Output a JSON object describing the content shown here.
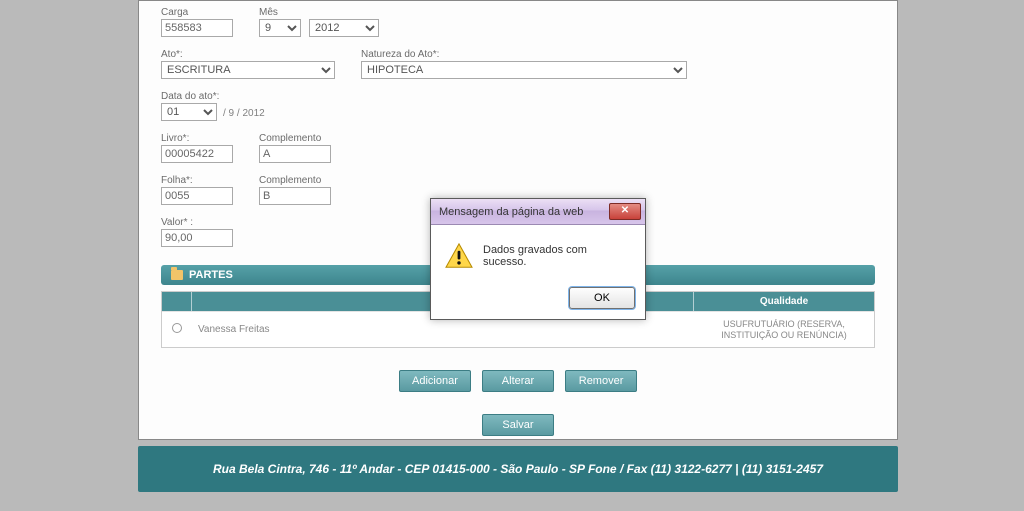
{
  "form": {
    "labels": {
      "carga": "Carga",
      "mes": "Mês",
      "ato": "Ato*:",
      "natureza": "Natureza do Ato*:",
      "dataAto": "Data do ato*:",
      "livro": "Livro*:",
      "complemento1": "Complemento",
      "folha": "Folha*:",
      "complemento2": "Complemento",
      "valor": "Valor* :"
    },
    "values": {
      "carga": "558583",
      "mes": "9",
      "ano": "2012",
      "ato": "ESCRITURA",
      "natureza": "HIPOTECA",
      "dia": "01",
      "dateTrail": "/ 9 / 2012",
      "livro": "00005422",
      "compLivro": "A",
      "folha": "0055",
      "compFolha": "B",
      "valor": "90,00"
    }
  },
  "partes": {
    "title": "PARTES",
    "headers": {
      "qualidade": "Qualidade"
    },
    "row": {
      "nome": "Vanessa Freitas",
      "qualidade": "USUFRUTUÁRIO (RESERVA, INSTITUIÇÃO OU RENÚNCIA)"
    }
  },
  "buttons": {
    "adicionar": "Adicionar",
    "alterar": "Alterar",
    "remover": "Remover",
    "salvar": "Salvar"
  },
  "footer": "Rua Bela Cintra, 746 - 11º Andar - CEP 01415-000 - São Paulo - SP Fone / Fax (11) 3122-6277 | (11) 3151-2457",
  "modal": {
    "title": "Mensagem da página da web",
    "message": "Dados gravados com sucesso.",
    "ok": "OK",
    "close": "✕"
  }
}
